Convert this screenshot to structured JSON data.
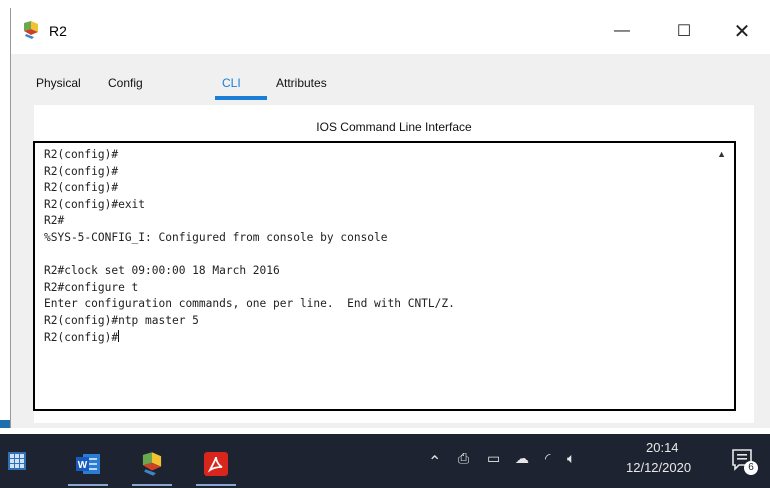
{
  "window": {
    "title": "R2",
    "minimize_glyph": "—",
    "maximize_glyph": "☐",
    "close_glyph": "✕"
  },
  "tabs": [
    {
      "label": "Physical",
      "active": false
    },
    {
      "label": "Config",
      "active": false
    },
    {
      "label": "CLI",
      "active": true
    },
    {
      "label": "Attributes",
      "active": false
    }
  ],
  "panel": {
    "title": "IOS Command Line Interface"
  },
  "terminal": {
    "lines": [
      "R2(config)#",
      "R2(config)#",
      "R2(config)#",
      "R2(config)#exit",
      "R2#",
      "%SYS-5-CONFIG_I: Configured from console by console",
      "",
      "R2#clock set 09:00:00 18 March 2016",
      "R2#configure t",
      "Enter configuration commands, one per line.  End with CNTL/Z.",
      "R2(config)#ntp master 5",
      "R2(config)#"
    ]
  },
  "taskbar": {
    "apps": [
      {
        "icon": "word-icon",
        "label": "W"
      },
      {
        "icon": "packet-tracer-icon",
        "label": ""
      },
      {
        "icon": "acrobat-icon",
        "label": ""
      }
    ],
    "clock_time": "20:14",
    "clock_date": "12/12/2020",
    "notification_count": "6"
  },
  "colors": {
    "accent": "#1a7ed6",
    "taskbar": "#1d2330"
  }
}
